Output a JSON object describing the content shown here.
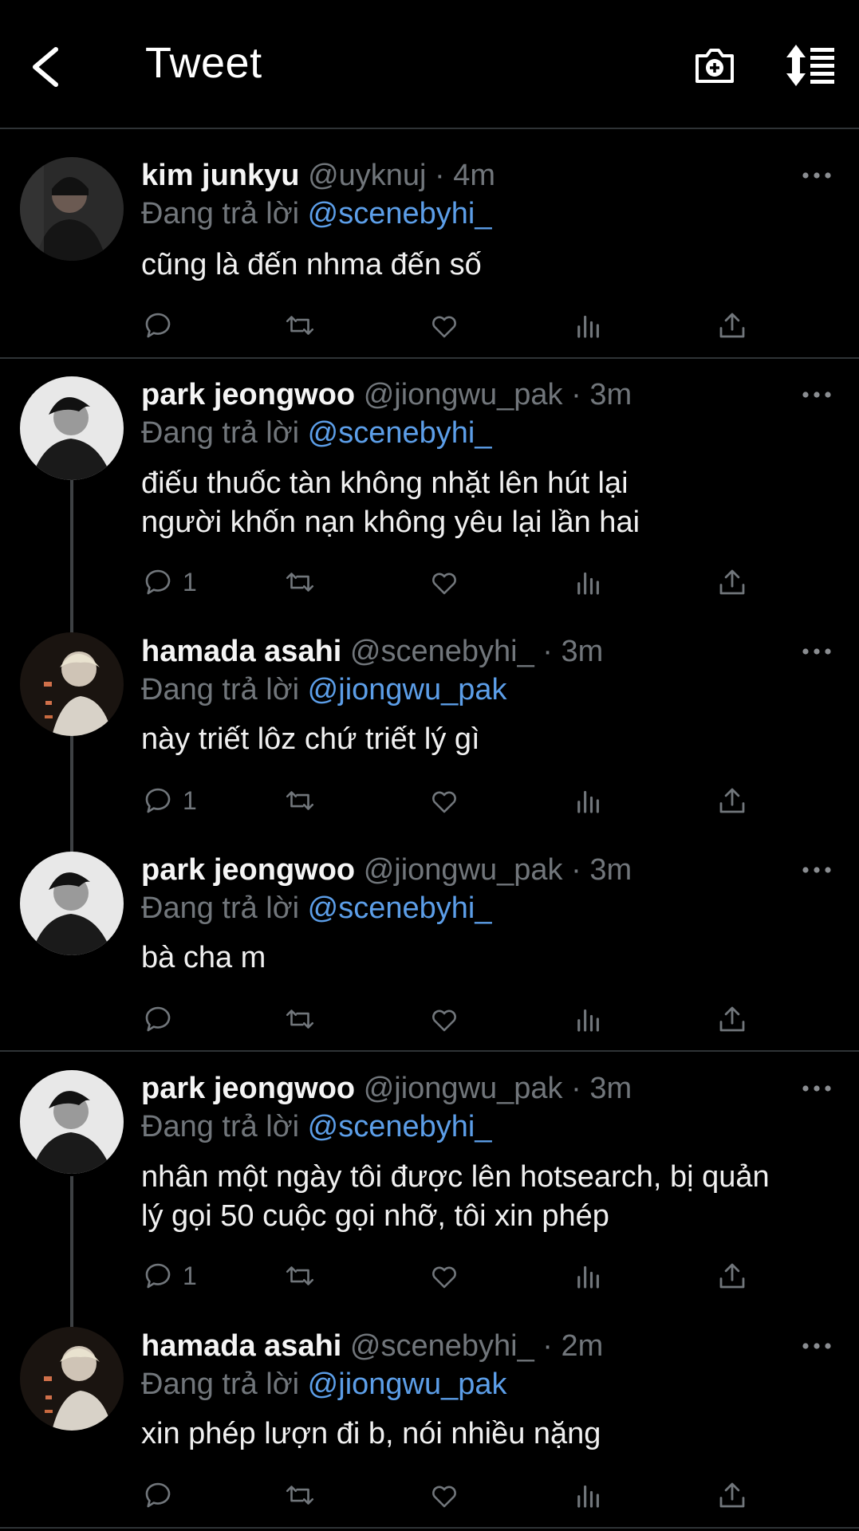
{
  "header": {
    "title": "Tweet"
  },
  "tweets": [
    {
      "name": "kim junkyu",
      "handle": "@uyknuj",
      "time": "· 4m",
      "reply_prefix": "Đang trả lời",
      "reply_to": "@scenebyhi_",
      "lines": [
        "cũng là đến nhma đến số"
      ],
      "reply_count": ""
    },
    {
      "name": "park jeongwoo",
      "handle": "@jiongwu_pak",
      "time": "· 3m",
      "reply_prefix": "Đang trả lời",
      "reply_to": "@scenebyhi_",
      "lines": [
        "điếu thuốc tàn không nhặt lên hút lại",
        "người khốn nạn không yêu lại lần hai"
      ],
      "reply_count": "1"
    },
    {
      "name": "hamada asahi",
      "handle": "@scenebyhi_",
      "time": "· 3m",
      "reply_prefix": "Đang trả lời",
      "reply_to": "@jiongwu_pak",
      "lines": [
        "này triết lôz chứ triết lý gì"
      ],
      "reply_count": "1"
    },
    {
      "name": "park jeongwoo",
      "handle": "@jiongwu_pak",
      "time": "· 3m",
      "reply_prefix": "Đang trả lời",
      "reply_to": "@scenebyhi_",
      "lines": [
        "bà cha m"
      ],
      "reply_count": ""
    },
    {
      "name": "park jeongwoo",
      "handle": "@jiongwu_pak",
      "time": "· 3m",
      "reply_prefix": "Đang trả lời",
      "reply_to": "@scenebyhi_",
      "lines": [
        "nhân một ngày tôi được lên hotsearch, bị quản",
        "lý gọi 50 cuộc gọi nhỡ, tôi xin phép"
      ],
      "reply_count": "1"
    },
    {
      "name": "hamada asahi",
      "handle": "@scenebyhi_",
      "time": "· 2m",
      "reply_prefix": "Đang trả lời",
      "reply_to": "@jiongwu_pak",
      "lines": [
        "xin phép lượn đi b, nói nhiều nặng"
      ],
      "reply_count": ""
    }
  ],
  "icons": {
    "back": "chevron-left-icon",
    "camera": "camera-add-icon",
    "sort": "sort-list-icon",
    "reply": "reply-icon",
    "retweet": "retweet-icon",
    "like": "heart-icon",
    "stats": "bar-chart-icon",
    "share": "share-icon",
    "more": "more-dots-icon"
  },
  "colors": {
    "background": "#000000",
    "mention": "#5c9ee8",
    "secondary": "#71767b",
    "divider": "#2f3336"
  }
}
